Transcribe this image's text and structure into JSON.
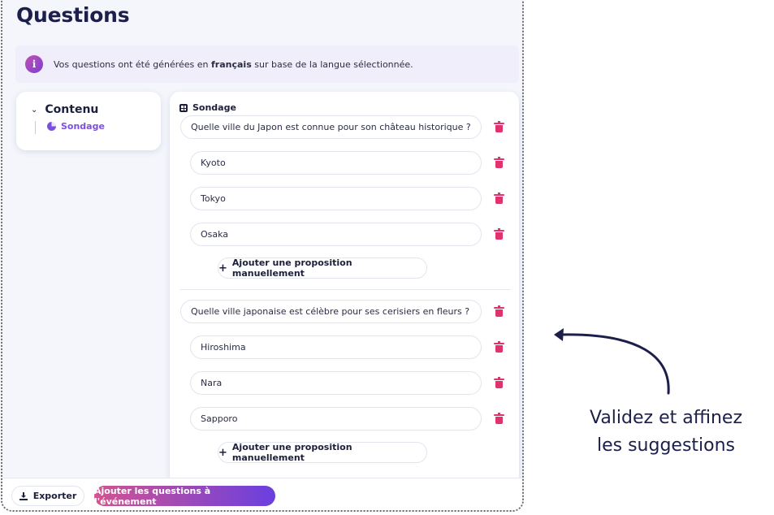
{
  "page": {
    "title": "Questions"
  },
  "banner": {
    "text_before": "Vos questions ont été générées en ",
    "language": "français",
    "text_after": " sur base de la langue sélectionnée."
  },
  "sidebar": {
    "section_label": "Contenu",
    "item_label": "Sondage"
  },
  "panel": {
    "title": "Sondage",
    "questions": [
      {
        "text": "Quelle ville du Japon est connue pour son château historique ?",
        "answers": [
          "Kyoto",
          "Tokyo",
          "Osaka"
        ],
        "add_label": "Ajouter une proposition manuellement"
      },
      {
        "text": "Quelle ville japonaise est célèbre pour ses cerisiers en fleurs ?",
        "answers": [
          "Hiroshima",
          "Nara",
          "Sapporo"
        ],
        "add_label": "Ajouter une proposition manuellement"
      }
    ]
  },
  "footer": {
    "export_label": "Exporter",
    "submit_label": "Ajouter les questions à l'événement"
  },
  "callout": {
    "line1": "Validez et affinez",
    "line2": "les suggestions"
  },
  "colors": {
    "accent": "#7b4fe0",
    "danger": "#e0336e",
    "gradient_start": "#d1548f",
    "gradient_end": "#6a3fe0",
    "text": "#1c1f3a"
  },
  "icons": [
    "info-icon",
    "chevron-down-icon",
    "pie-chart-icon",
    "table-icon",
    "trash-icon",
    "plus-icon",
    "download-icon",
    "curved-arrow-icon"
  ]
}
